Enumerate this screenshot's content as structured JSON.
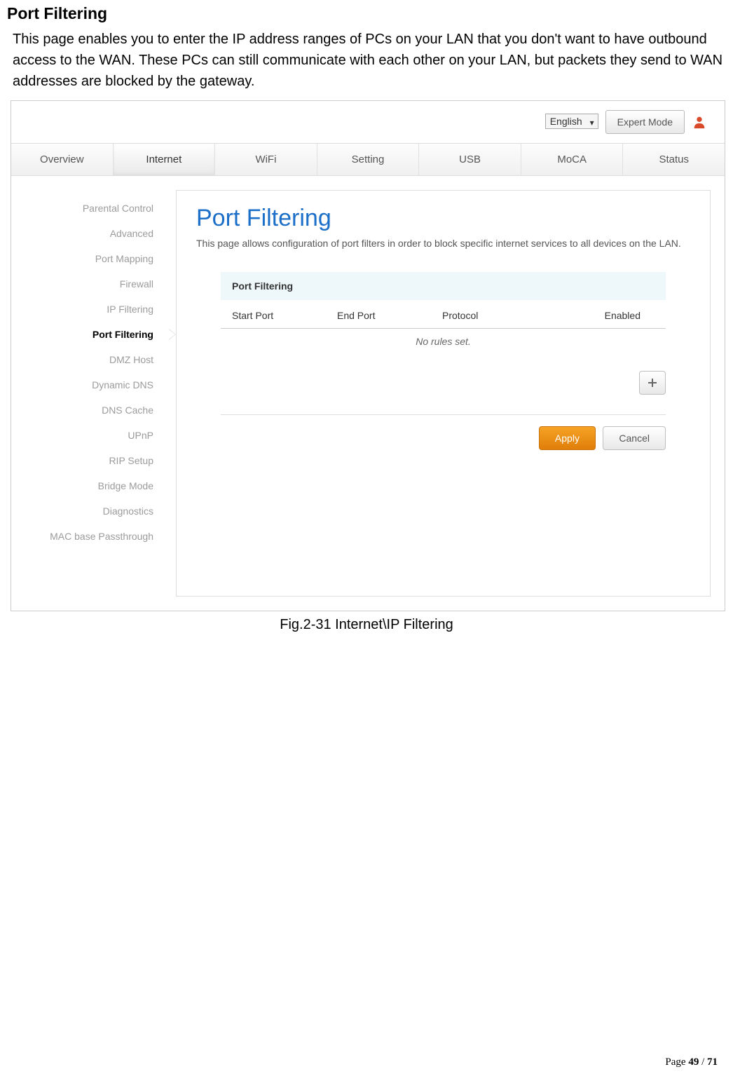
{
  "doc": {
    "title": "Port Filtering",
    "intro": "This page enables you to enter the IP address ranges of PCs on your LAN that you don't want to have outbound access to the WAN. These PCs can still communicate with each other on your LAN, but packets they send to WAN addresses are blocked by the gateway.",
    "caption": "Fig.2-31 Internet\\IP Filtering",
    "page_label_prefix": "Page ",
    "page_current": "49",
    "page_sep": " / ",
    "page_total": "71"
  },
  "topbar": {
    "language": "English",
    "expert_mode": "Expert Mode"
  },
  "tabs": [
    "Overview",
    "Internet",
    "WiFi",
    "Setting",
    "USB",
    "MoCA",
    "Status"
  ],
  "active_tab_index": 1,
  "sidebar": {
    "items": [
      "Parental Control",
      "Advanced",
      "Port Mapping",
      "Firewall",
      "IP Filtering",
      "Port Filtering",
      "DMZ Host",
      "Dynamic DNS",
      "DNS Cache",
      "UPnP",
      "RIP Setup",
      "Bridge Mode",
      "Diagnostics",
      "MAC base Passthrough"
    ],
    "active_index": 5
  },
  "panel": {
    "heading": "Port Filtering",
    "description": "This page allows configuration of port filters in order to block specific internet services to all devices on the LAN.",
    "section_title": "Port Filtering",
    "columns": {
      "start": "Start Port",
      "end": "End Port",
      "protocol": "Protocol",
      "enabled": "Enabled"
    },
    "no_rules": "No rules set.",
    "apply": "Apply",
    "cancel": "Cancel"
  }
}
